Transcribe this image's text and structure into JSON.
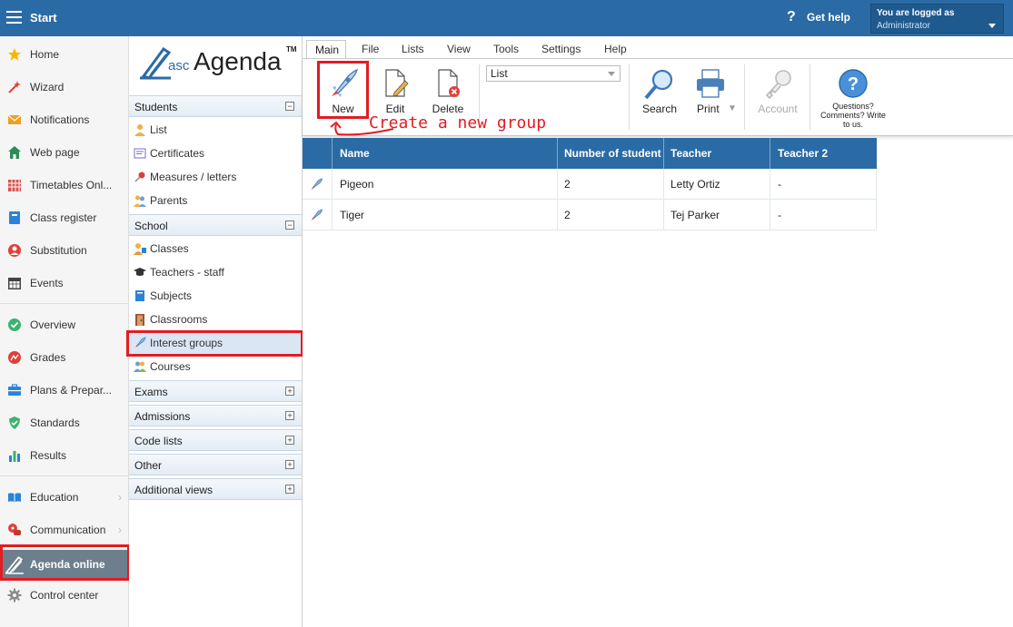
{
  "topbar": {
    "start_label": "Start",
    "help_label": "Get help",
    "logged_in_line": "You are logged as",
    "user_role": "Administrator"
  },
  "leftnav": {
    "items": [
      {
        "label": "Home",
        "icon": "star-icon"
      },
      {
        "label": "Wizard",
        "icon": "wand-icon"
      },
      {
        "label": "Notifications",
        "icon": "envelope-icon"
      },
      {
        "label": "Web page",
        "icon": "house-icon"
      },
      {
        "label": "Timetables Onl...",
        "icon": "calendar-grid-icon"
      },
      {
        "label": "Class register",
        "icon": "book-icon"
      },
      {
        "label": "Substitution",
        "icon": "person-icon"
      },
      {
        "label": "Events",
        "icon": "calendar-icon"
      },
      {
        "label": "Overview",
        "icon": "check-circle-icon"
      },
      {
        "label": "Grades",
        "icon": "grades-icon"
      },
      {
        "label": "Plans & Prepar...",
        "icon": "briefcase-icon"
      },
      {
        "label": "Standards",
        "icon": "shield-check-icon"
      },
      {
        "label": "Results",
        "icon": "bar-chart-icon"
      },
      {
        "label": "Education",
        "icon": "open-book-icon"
      },
      {
        "label": "Communication",
        "icon": "chat-icon"
      },
      {
        "label": "Agenda online",
        "icon": "agenda-logo-icon"
      },
      {
        "label": "Control center",
        "icon": "gear-icon"
      }
    ]
  },
  "logo": {
    "prefix": "asc",
    "name": "Agenda",
    "tm": "TM"
  },
  "sidebar": {
    "students": {
      "title": "Students",
      "items": [
        "List",
        "Certificates",
        "Measures / letters",
        "Parents"
      ]
    },
    "school": {
      "title": "School",
      "items": [
        "Classes",
        "Teachers - staff",
        "Subjects",
        "Classrooms",
        "Interest groups",
        "Courses"
      ]
    },
    "collapsed": [
      "Exams",
      "Admissions",
      "Code lists",
      "Other",
      "Additional views"
    ]
  },
  "menubar": [
    "Main",
    "File",
    "Lists",
    "View",
    "Tools",
    "Settings",
    "Help"
  ],
  "ribbon": {
    "new_label": "New",
    "edit_label": "Edit",
    "delete_label": "Delete",
    "view_select": "List",
    "search_label": "Search",
    "print_label": "Print",
    "account_label": "Account",
    "feedback_label_1": "Questions?",
    "feedback_label_2": "Comments? Write",
    "feedback_label_3": "to us."
  },
  "annotation": {
    "callout": "Create a new group",
    "accent": "#e31b23"
  },
  "table": {
    "columns": [
      "Name",
      "Number of student",
      "Teacher",
      "Teacher 2"
    ],
    "rows": [
      {
        "name": "Pigeon",
        "students": "2",
        "teacher": "Letty Ortiz",
        "teacher2": "-"
      },
      {
        "name": "Tiger",
        "students": "2",
        "teacher": "Tej Parker",
        "teacher2": "-"
      }
    ]
  },
  "colors": {
    "brand": "#2b6ba5",
    "active_nav": "#6d7f8c",
    "selected_row": "#dbe6f5"
  }
}
